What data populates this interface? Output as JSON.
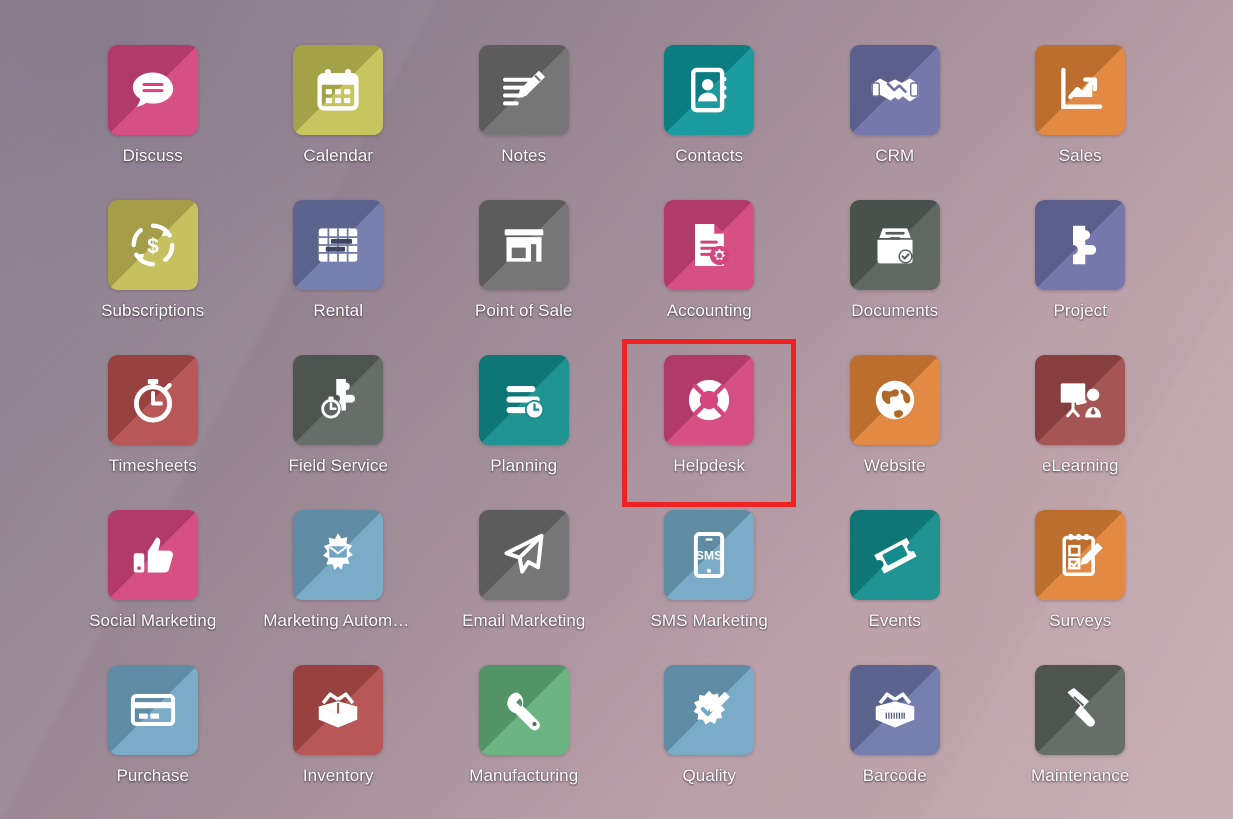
{
  "screen": {
    "kind": "odoo-apps-launcher",
    "background_top_left": "#877a8c",
    "background_bottom_right": "#c6abb1",
    "highlight_color": "#ee2222",
    "highlighted_app": "Helpdesk",
    "columns": 6,
    "rows": 5
  },
  "apps": [
    {
      "label": "Discuss",
      "icon": "chat-bubble-icon",
      "color": "#d4457d"
    },
    {
      "label": "Calendar",
      "icon": "calendar-icon",
      "color": "#c3c155"
    },
    {
      "label": "Notes",
      "icon": "note-pencil-icon",
      "color": "#6e6e6e"
    },
    {
      "label": "Contacts",
      "icon": "address-book-icon",
      "color": "#0d9598"
    },
    {
      "label": "CRM",
      "icon": "handshake-icon",
      "color": "#6d70a6"
    },
    {
      "label": "Sales",
      "icon": "growth-chart-icon",
      "color": "#e08337"
    },
    {
      "label": "Subscriptions",
      "icon": "recurring-dollar-icon",
      "color": "#c3bc56"
    },
    {
      "label": "Rental",
      "icon": "rental-gantt-icon",
      "color": "#6d77a8"
    },
    {
      "label": "Point of Sale",
      "icon": "storefront-icon",
      "color": "#6e6e6e"
    },
    {
      "label": "Accounting",
      "icon": "invoice-gear-icon",
      "color": "#d4457d"
    },
    {
      "label": "Documents",
      "icon": "file-drawer-check-icon",
      "color": "#56605a"
    },
    {
      "label": "Project",
      "icon": "puzzle-piece-icon",
      "color": "#6d70a6"
    },
    {
      "label": "Timesheets",
      "icon": "stopwatch-icon",
      "color": "#b44d4d"
    },
    {
      "label": "Field Service",
      "icon": "puzzle-stopwatch-icon",
      "color": "#5d6560"
    },
    {
      "label": "Planning",
      "icon": "planning-bars-clock-icon",
      "color": "#128c8c"
    },
    {
      "label": "Helpdesk",
      "icon": "lifebuoy-icon",
      "color": "#d4457d"
    },
    {
      "label": "Website",
      "icon": "globe-icon",
      "color": "#e08337"
    },
    {
      "label": "eLearning",
      "icon": "whiteboard-teacher-icon",
      "color": "#a04a4a"
    },
    {
      "label": "Social Marketing",
      "icon": "thumbs-up-icon",
      "color": "#d4457d"
    },
    {
      "label": "Marketing Automat…",
      "icon": "gear-envelope-icon",
      "color": "#72a6c4"
    },
    {
      "label": "Email Marketing",
      "icon": "paper-plane-icon",
      "color": "#6e6e6e"
    },
    {
      "label": "SMS Marketing",
      "icon": "sms-phone-icon",
      "color": "#72a6c4"
    },
    {
      "label": "Events",
      "icon": "ticket-icon",
      "color": "#128c8c"
    },
    {
      "label": "Surveys",
      "icon": "clipboard-pencil-icon",
      "color": "#e08337"
    },
    {
      "label": "Purchase",
      "icon": "credit-card-icon",
      "color": "#72a6c4"
    },
    {
      "label": "Inventory",
      "icon": "open-box-icon",
      "color": "#b44d4d"
    },
    {
      "label": "Manufacturing",
      "icon": "wrench-icon",
      "color": "#63b07a"
    },
    {
      "label": "Quality",
      "icon": "quality-badge-pencil-icon",
      "color": "#72a6c4"
    },
    {
      "label": "Barcode",
      "icon": "barcode-box-icon",
      "color": "#6d77a8"
    },
    {
      "label": "Maintenance",
      "icon": "hammer-icon",
      "color": "#5d6560"
    }
  ]
}
